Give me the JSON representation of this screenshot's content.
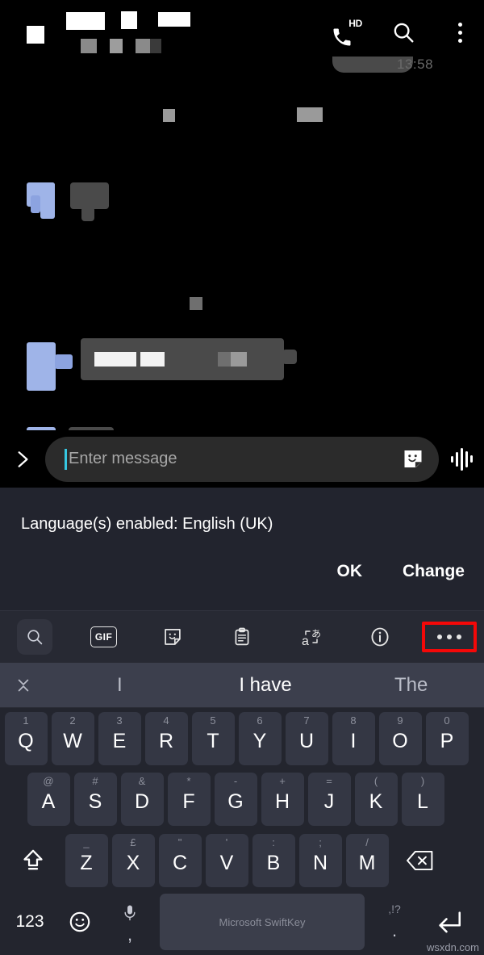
{
  "app": {
    "title_redacted": true,
    "contact_name": "",
    "contact_status": ""
  },
  "appbar": {
    "call_icon": "phone-hd-icon",
    "hd_label": "HD",
    "search_icon": "search-icon",
    "overflow_icon": "overflow-menu-icon"
  },
  "messages": {
    "top_timestamp": "13:58",
    "items": [
      {
        "id": "msg-1",
        "type": "incoming",
        "redacted": true
      },
      {
        "id": "msg-2",
        "type": "incoming",
        "redacted": true
      },
      {
        "id": "msg-3",
        "type": "incoming",
        "redacted": true
      }
    ]
  },
  "composer": {
    "expand_icon": "chevron-right-icon",
    "placeholder": "Enter message",
    "value": "",
    "sticker_icon": "sticker-icon",
    "voice_icon": "audio-waveform-icon"
  },
  "language_notice": {
    "text": "Language(s) enabled: English (UK)",
    "ok_label": "OK",
    "change_label": "Change"
  },
  "toolbar": {
    "items": [
      {
        "name": "search-icon",
        "label": "",
        "active": true
      },
      {
        "name": "gif-icon",
        "label": "GIF",
        "active": false
      },
      {
        "name": "sticker-icon",
        "label": "",
        "active": false
      },
      {
        "name": "clipboard-icon",
        "label": "",
        "active": false
      },
      {
        "name": "translate-icon",
        "label": "",
        "active": false
      },
      {
        "name": "info-icon",
        "label": "",
        "active": false
      },
      {
        "name": "more-options-icon",
        "label": "",
        "active": false,
        "highlighted": true
      }
    ],
    "highlight_color": "#f40808"
  },
  "predictions": {
    "collapse_icon": "collapse-icon",
    "items": [
      {
        "text": "I",
        "primary": false
      },
      {
        "text": "I have",
        "primary": true
      },
      {
        "text": "The",
        "primary": false
      }
    ]
  },
  "keyboard": {
    "row1": [
      {
        "main": "Q",
        "sup": "1"
      },
      {
        "main": "W",
        "sup": "2"
      },
      {
        "main": "E",
        "sup": "3"
      },
      {
        "main": "R",
        "sup": "4"
      },
      {
        "main": "T",
        "sup": "5"
      },
      {
        "main": "Y",
        "sup": "6"
      },
      {
        "main": "U",
        "sup": "7"
      },
      {
        "main": "I",
        "sup": "8"
      },
      {
        "main": "O",
        "sup": "9"
      },
      {
        "main": "P",
        "sup": "0"
      }
    ],
    "row2": [
      {
        "main": "A",
        "sup": "@"
      },
      {
        "main": "S",
        "sup": "#"
      },
      {
        "main": "D",
        "sup": "&"
      },
      {
        "main": "F",
        "sup": "*"
      },
      {
        "main": "G",
        "sup": "-"
      },
      {
        "main": "H",
        "sup": "+"
      },
      {
        "main": "J",
        "sup": "="
      },
      {
        "main": "K",
        "sup": "("
      },
      {
        "main": "L",
        "sup": ")"
      }
    ],
    "row3": [
      {
        "main": "Z",
        "sup": "_"
      },
      {
        "main": "X",
        "sup": "£"
      },
      {
        "main": "C",
        "sup": "\""
      },
      {
        "main": "V",
        "sup": "'"
      },
      {
        "main": "B",
        "sup": ":"
      },
      {
        "main": "N",
        "sup": ";"
      },
      {
        "main": "M",
        "sup": "/"
      }
    ],
    "shift_icon": "shift-icon",
    "backspace_icon": "backspace-icon",
    "numeric_label": "123",
    "emoji_icon": "emoji-icon",
    "mic_icon": "microphone-icon",
    "comma_label": ",",
    "space_label": "Microsoft SwiftKey",
    "period_label": ".",
    "punct_sup": ",!?",
    "enter_icon": "enter-icon"
  },
  "watermark": {
    "text": "wsxdn.com"
  },
  "colors": {
    "chat_bg": "#000000",
    "bubble": "#4a4a4a",
    "avatar": "#9fb4e8",
    "panel_bg": "#22242e",
    "toolbar_bg": "#272933",
    "prediction_bg": "#3c3f4d",
    "keyboard_bg": "#23252e",
    "key_bg": "#343744",
    "highlight": "#f40808",
    "caret": "#36c6e0"
  }
}
